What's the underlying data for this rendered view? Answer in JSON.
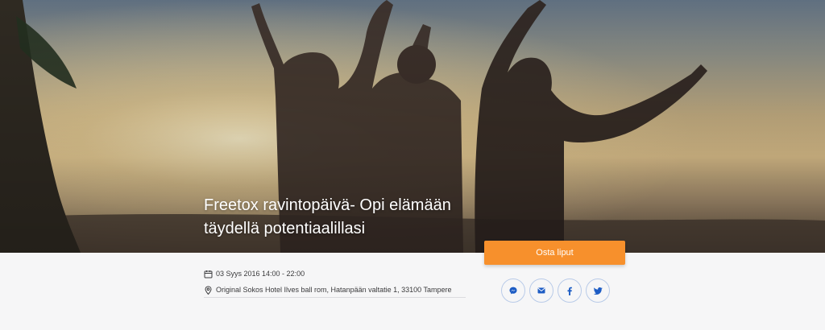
{
  "event": {
    "title": "Freetox ravintopäivä- Opi elämään täydellä potentiaalillasi",
    "date": "03 Syys 2016 14:00 - 22:00",
    "location": "Original Sokos Hotel Ilves ball rom, Hatanpään valtatie 1, 33100 Tampere"
  },
  "actions": {
    "buy_label": "Osta liput",
    "share_icons": [
      "messenger-icon",
      "email-icon",
      "facebook-icon",
      "twitter-icon"
    ]
  },
  "colors": {
    "accent": "#f7902c",
    "share_border": "#b9cbe8",
    "share_icon": "#1d5cc4",
    "background": "#f6f6f7"
  }
}
